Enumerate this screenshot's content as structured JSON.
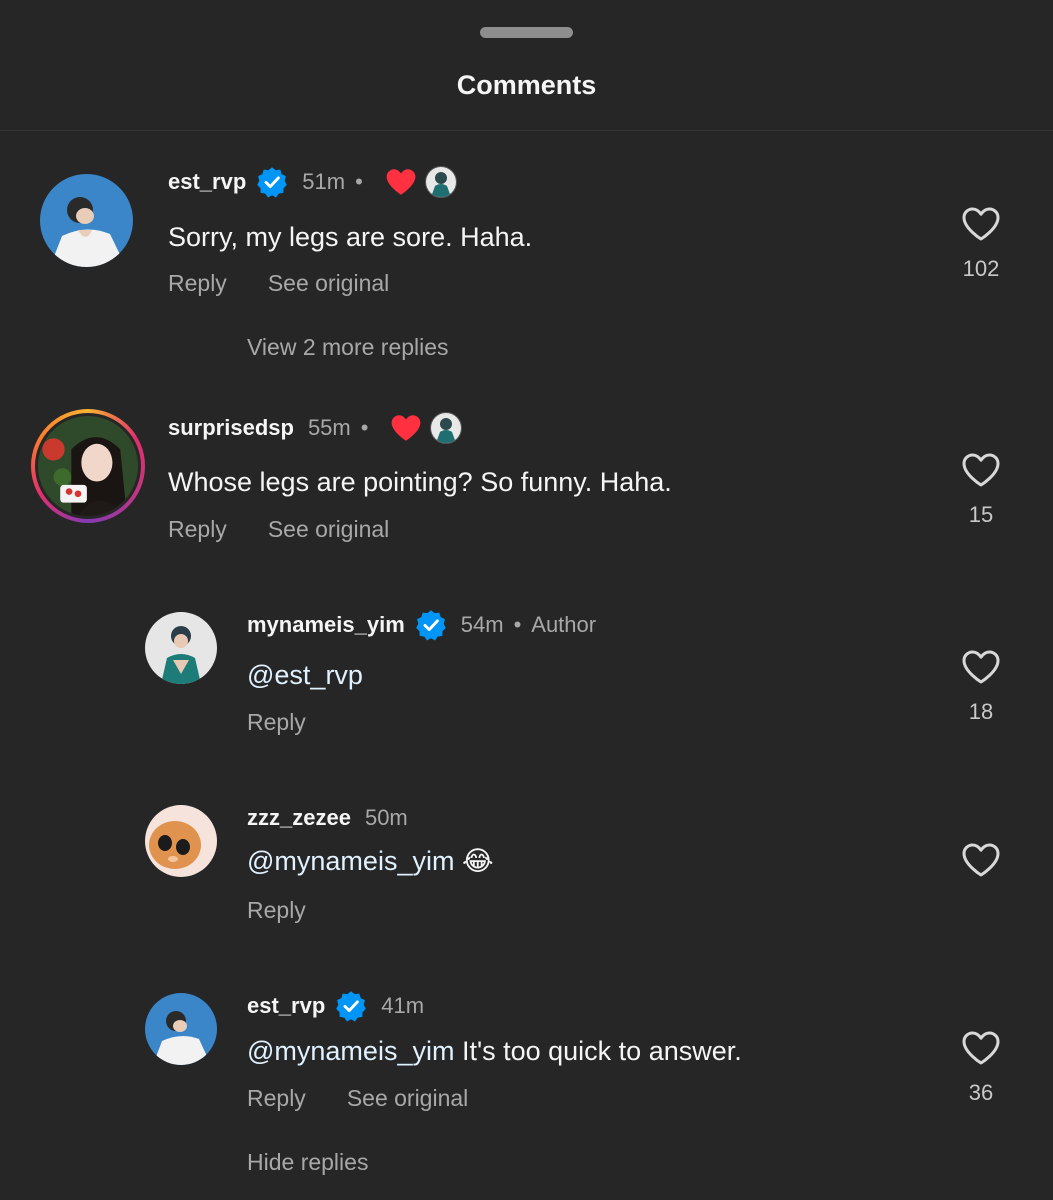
{
  "sheet": {
    "title": "Comments"
  },
  "comments": [
    {
      "username": "est_rvp",
      "verified": true,
      "time": "51m",
      "creator_liked": true,
      "text": "Sorry, my legs are sore. Haha.",
      "actions": [
        "Reply",
        "See original"
      ],
      "likes": "102",
      "view_more": "View 2 more replies"
    },
    {
      "username": "surprisedsp",
      "verified": false,
      "time": "55m",
      "creator_liked": true,
      "text": "Whose legs are pointing? So funny. Haha.",
      "actions": [
        "Reply",
        "See original"
      ],
      "likes": "15",
      "replies": [
        {
          "username": "mynameis_yim",
          "verified": true,
          "time": "54m",
          "badge": "Author",
          "mention": "@est_rvp",
          "text": "",
          "actions": [
            "Reply"
          ],
          "likes": "18"
        },
        {
          "username": "zzz_zezee",
          "verified": false,
          "time": "50m",
          "mention": "@mynameis_yim",
          "text": "",
          "emoji": "😂",
          "actions": [
            "Reply"
          ],
          "likes": ""
        },
        {
          "username": "est_rvp",
          "verified": true,
          "time": "41m",
          "mention": "@mynameis_yim",
          "text": " It's too quick to answer.",
          "actions": [
            "Reply",
            "See original"
          ],
          "likes": "36"
        }
      ],
      "hide_replies": "Hide replies"
    }
  ],
  "colors": {
    "background": "#262626",
    "verified_blue": "#0095f6",
    "heart_red": "#ff3040",
    "secondary_text": "#a8a8a8"
  },
  "icons": {
    "verified": "verified-badge-icon",
    "like": "heart-outline-icon",
    "creator_like": "heart-filled-icon"
  }
}
